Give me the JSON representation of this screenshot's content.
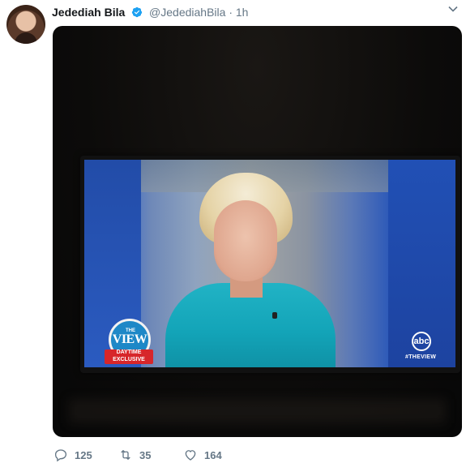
{
  "tweet": {
    "author_name": "Jedediah Bila",
    "author_handle": "@JedediahBila",
    "separator": "·",
    "timestamp": "1h"
  },
  "media": {
    "show_logo": {
      "the": "THE",
      "view": "VIEW",
      "banner_line1": "DAYTIME",
      "banner_line2": "EXCLUSIVE"
    },
    "network": "abc",
    "hashtag": "#THEVIEW"
  },
  "actions": {
    "reply_count": "125",
    "retweet_count": "35",
    "like_count": "164"
  },
  "colors": {
    "verified": "#1da1f2",
    "muted_text": "#657786",
    "name_text": "#14171a"
  },
  "icons": [
    "verified-badge-icon",
    "chevron-down-icon",
    "reply-icon",
    "retweet-icon",
    "like-icon"
  ]
}
